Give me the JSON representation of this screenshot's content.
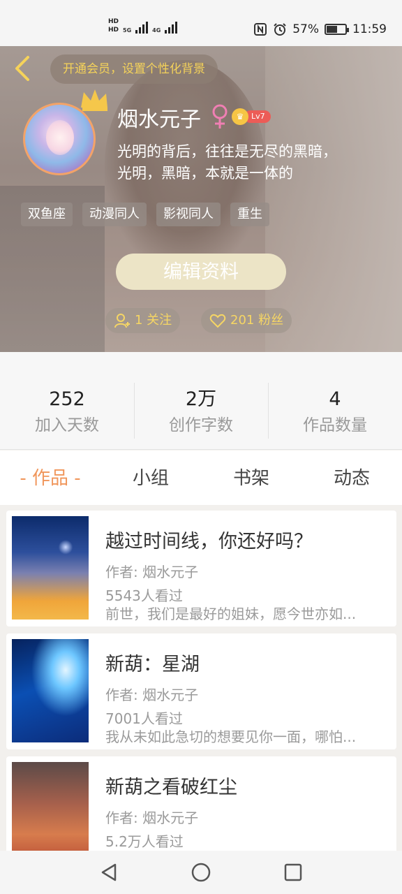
{
  "status_bar": {
    "hd1": "HD",
    "net1": "5G",
    "hd2": "HD",
    "net2": "4G",
    "battery_percent": "57%",
    "battery_level": 0.57,
    "time": "11:59"
  },
  "header": {
    "vip_prompt": "开通会员，设置个性化背景",
    "username": "烟水元子",
    "level": "Lv7",
    "bio_line1": "光明的背后，往往是无尽的黑暗，",
    "bio_line2": "光明，黑暗，本就是一体的",
    "tags": [
      "双鱼座",
      "动漫同人",
      "影视同人",
      "重生"
    ],
    "edit_button": "编辑资料",
    "follow": "1 关注",
    "fans": "201 粉丝"
  },
  "stats": [
    {
      "value": "252",
      "label": "加入天数"
    },
    {
      "value": "2万",
      "label": "创作字数"
    },
    {
      "value": "4",
      "label": "作品数量"
    }
  ],
  "tabs": [
    "- 作品 -",
    "小组",
    "书架",
    "动态"
  ],
  "books": [
    {
      "title": "越过时间线，你还好吗？",
      "author": "作者: 烟水元子",
      "views": "5543人看过",
      "desc": "前世，我们是最好的姐妹，愿今世亦如..."
    },
    {
      "title": "新葫：星湖",
      "author": "作者: 烟水元子",
      "views": "7001人看过",
      "desc": "我从未如此急切的想要见你一面，哪怕..."
    },
    {
      "title": "新葫之看破红尘",
      "author": "作者: 烟水元子",
      "views": "5.2万人看过",
      "desc": ""
    }
  ],
  "colors": {
    "accent": "#f0965b",
    "vip_text": "#f4d25a",
    "level_badge": "#ec5c57",
    "avatar_ring": "#f3a368"
  },
  "icons": {
    "back": "chevron-left-icon",
    "crown": "crown-icon",
    "gender": "female-icon",
    "follow": "add-user-icon",
    "fans": "heart-icon",
    "nav_back": "triangle-back-icon",
    "nav_home": "circle-home-icon",
    "nav_recent": "square-recent-icon"
  }
}
